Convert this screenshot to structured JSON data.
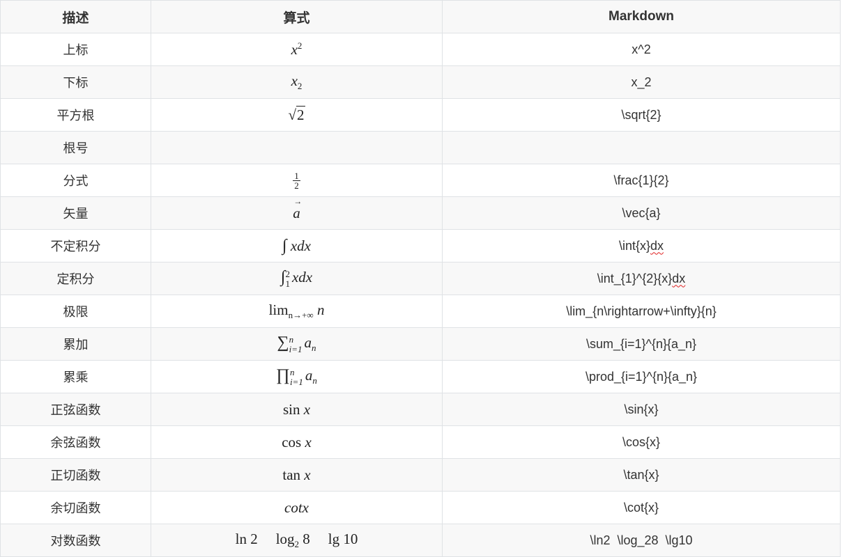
{
  "headers": [
    "描述",
    "算式",
    "Markdown"
  ],
  "rows": [
    {
      "desc": "上标",
      "formula": "x^2",
      "markdown": "x^2"
    },
    {
      "desc": "下标",
      "formula": "x_2",
      "markdown": "x_2"
    },
    {
      "desc": "平方根",
      "formula": "√2",
      "markdown": "\\sqrt{2}"
    },
    {
      "desc": "根号",
      "formula": "",
      "markdown": ""
    },
    {
      "desc": "分式",
      "formula": "1/2",
      "markdown": "\\frac{1}{2}"
    },
    {
      "desc": "矢量",
      "formula": "a",
      "markdown": "\\vec{a}"
    },
    {
      "desc": "不定积分",
      "formula": "∫xdx",
      "markdown_parts": [
        "\\int{x}",
        "dx"
      ]
    },
    {
      "desc": "定积分",
      "formula": "∫_1^2 xdx",
      "markdown_parts": [
        "\\int_{1}^{2}{x}",
        "dx"
      ]
    },
    {
      "desc": "极限",
      "formula": "lim n→+∞ n",
      "markdown": "\\lim_{n\\rightarrow+\\infty}{n}"
    },
    {
      "desc": "累加",
      "formula": "∑ i=1 n a_n",
      "markdown": "\\sum_{i=1}^{n}{a_n}"
    },
    {
      "desc": "累乘",
      "formula": "∏ i=1 n a_n",
      "markdown": "\\prod_{i=1}^{n}{a_n}"
    },
    {
      "desc": "正弦函数",
      "formula": "sin x",
      "markdown": "\\sin{x}"
    },
    {
      "desc": "余弦函数",
      "formula": "cos x",
      "markdown": "\\cos{x}"
    },
    {
      "desc": "正切函数",
      "formula": "tan x",
      "markdown": "\\tan{x}"
    },
    {
      "desc": "余切函数",
      "formula": "cotx",
      "markdown": "\\cot{x}"
    },
    {
      "desc": "对数函数",
      "formula": "ln 2  log2 8  lg 10",
      "markdown": "\\ln2  \\log_28  \\lg10"
    }
  ],
  "math": {
    "x": "x",
    "two": "2",
    "one": "1",
    "a": "a",
    "n": "n",
    "i1": "i=1",
    "dx": "dx",
    "int": "∫",
    "sum": "∑",
    "prod": "∏",
    "sqrt": "√",
    "lim": "lim",
    "ninf": "n→+∞",
    "sin": "sin",
    "cos": "cos",
    "tan": "tan",
    "cot": "cot",
    "ln": "ln",
    "log": "log",
    "lg": "lg",
    "eight": "8",
    "ten": "10"
  }
}
